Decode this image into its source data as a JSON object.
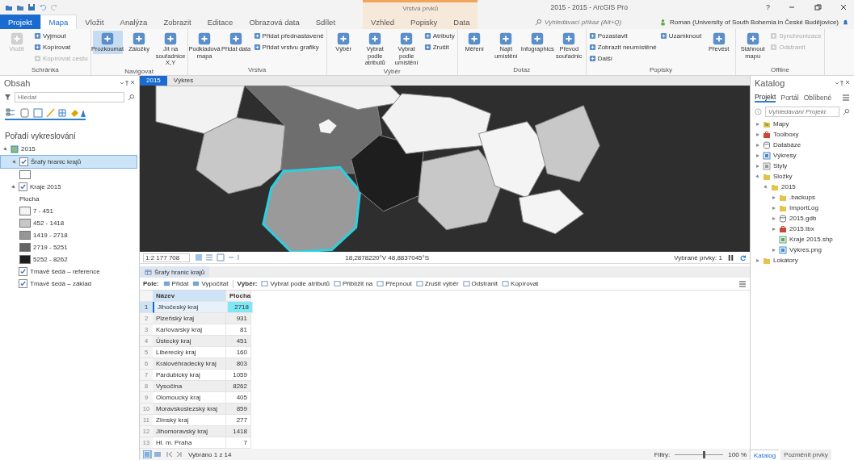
{
  "window": {
    "title": "2015 - 2015 - ArcGIS Pro",
    "context_label": "Vrstva prvků",
    "help": "?"
  },
  "ribbon_tabs": [
    {
      "label": "Projekt",
      "kind": "app",
      "selected": false
    },
    {
      "label": "Mapa",
      "kind": "normal",
      "selected": true
    },
    {
      "label": "Vložit",
      "kind": "normal",
      "selected": false
    },
    {
      "label": "Analýza",
      "kind": "normal",
      "selected": false
    },
    {
      "label": "Zobrazit",
      "kind": "normal",
      "selected": false
    },
    {
      "label": "Editace",
      "kind": "normal",
      "selected": false
    },
    {
      "label": "Obrazová data",
      "kind": "normal",
      "selected": false
    },
    {
      "label": "Sdílet",
      "kind": "normal",
      "selected": false
    },
    {
      "label": "Vzhled",
      "kind": "context",
      "selected": false
    },
    {
      "label": "Popisky",
      "kind": "context",
      "selected": false
    },
    {
      "label": "Data",
      "kind": "context",
      "selected": false
    }
  ],
  "command_search": {
    "placeholder": "Vyhledávací příkaz (Alt+Q)"
  },
  "user": "Roman (University of South Bohemia in České Budějovice)",
  "ribbon_groups": [
    {
      "name": "Schránka",
      "buttons": [
        {
          "label": "Vložit",
          "kind": "large",
          "disabled": true
        },
        {
          "label": "Vyjmout",
          "kind": "small",
          "disabled": false
        },
        {
          "label": "Kopírovat",
          "kind": "small",
          "disabled": false
        },
        {
          "label": "Kopírovat cestu",
          "kind": "small",
          "disabled": true
        }
      ]
    },
    {
      "name": "Navigovat",
      "buttons": [
        {
          "label": "Prozkoumat",
          "kind": "large",
          "disabled": false,
          "selected": true
        },
        {
          "label": "Záložky",
          "kind": "large",
          "disabled": false,
          "selected": false
        },
        {
          "label": "Jít na souřadnice X,Y",
          "kind": "large",
          "disabled": false,
          "selected": false
        }
      ]
    },
    {
      "name": "Vrstva",
      "buttons": [
        {
          "label": "Podkladová mapa",
          "kind": "large",
          "disabled": false
        },
        {
          "label": "Přidat data",
          "kind": "large",
          "disabled": false
        },
        {
          "label": "Přidat přednastavené",
          "kind": "small",
          "disabled": false
        },
        {
          "label": "Přidat vrstvu grafiky",
          "kind": "small",
          "disabled": false
        }
      ]
    },
    {
      "name": "Výběr",
      "buttons": [
        {
          "label": "Výběr",
          "kind": "large",
          "disabled": false
        },
        {
          "label": "Vybrat podle atributů",
          "kind": "large",
          "disabled": false
        },
        {
          "label": "Vybrat podle umístění",
          "kind": "large",
          "disabled": false
        },
        {
          "label": "Atributy",
          "kind": "small",
          "disabled": false
        },
        {
          "label": "Zrušit",
          "kind": "small",
          "disabled": false
        }
      ]
    },
    {
      "name": "Dotaz",
      "buttons": [
        {
          "label": "Měření",
          "kind": "large",
          "disabled": false
        },
        {
          "label": "Najít umístění",
          "kind": "large",
          "disabled": false
        },
        {
          "label": "Infographics",
          "kind": "large",
          "disabled": false
        },
        {
          "label": "Převod souřadnic",
          "kind": "large",
          "disabled": false
        }
      ]
    },
    {
      "name": "Popisky",
      "buttons": [
        {
          "label": "Pozastavit",
          "kind": "small",
          "disabled": false
        },
        {
          "label": "Zobrazit neumístěné",
          "kind": "small",
          "disabled": false
        },
        {
          "label": "Další",
          "kind": "small",
          "disabled": false
        },
        {
          "label": "Uzamknout",
          "kind": "small",
          "disabled": false
        },
        {
          "label": "Převést",
          "kind": "large",
          "disabled": false
        }
      ]
    },
    {
      "name": "Offline",
      "buttons": [
        {
          "label": "Stáhnout mapu",
          "kind": "large",
          "disabled": false
        },
        {
          "label": "Synchronizace",
          "kind": "small",
          "disabled": true
        },
        {
          "label": "Odstranit",
          "kind": "small",
          "disabled": true
        }
      ]
    }
  ],
  "contents": {
    "title": "Obsah",
    "search_placeholder": "Hledat",
    "heading": "Pořadí vykreslování",
    "tree": [
      {
        "label": "2015",
        "kind": "map",
        "expanded": true,
        "children": [
          {
            "label": "Šrafy hranic krajů",
            "checked": true,
            "selected": true,
            "expanded": true,
            "legend": {
              "classes": [
                {
                  "color": "#ffffff"
                }
              ]
            }
          },
          {
            "label": "Kraje 2015",
            "checked": true,
            "selected": false,
            "expanded": true,
            "legend": {
              "heading": "Plocha",
              "classes": [
                {
                  "label": "7 - 451",
                  "color": "#f4f4f4"
                },
                {
                  "label": "452 - 1418",
                  "color": "#c8c8c8"
                },
                {
                  "label": "1419 - 2718",
                  "color": "#969696"
                },
                {
                  "label": "2719 - 5251",
                  "color": "#646464"
                },
                {
                  "label": "5252 - 8262",
                  "color": "#1e1e1e"
                }
              ]
            }
          },
          {
            "label": "Tmavě šedá – reference",
            "checked": true,
            "selected": false
          },
          {
            "label": "Tmavě šedá – základ",
            "checked": true,
            "selected": false
          }
        ]
      }
    ]
  },
  "map_tabs": [
    {
      "label": "2015",
      "selected": true
    },
    {
      "label": "Výkres",
      "selected": false
    }
  ],
  "map_status": {
    "scale": "1:2 177 708",
    "coordinates": "18,2878220°V 48,8837045°S",
    "selected_features": "Vybrané prvky: 1"
  },
  "table_tab": {
    "label": "Šrafy hranic krajů"
  },
  "table_toolbar": {
    "field_label": "Pole:",
    "field_buttons": [
      "Přidat",
      "Vypočítat"
    ],
    "selection_label": "Výběr:",
    "selection_buttons": [
      "Vybrat podle atributů",
      "Přiblížit na",
      "Přepnout",
      "Zrušit výběr",
      "Odstranit",
      "Kopírovat"
    ]
  },
  "table": {
    "columns": [
      "Název",
      "Plocha"
    ],
    "rows": [
      {
        "index": "1",
        "name": "Jihočeský kraj",
        "area": "2718",
        "selected": true
      },
      {
        "index": "2",
        "name": "Plzeňský kraj",
        "area": "931",
        "selected": false
      },
      {
        "index": "3",
        "name": "Karlovarský kraj",
        "area": "81",
        "selected": false
      },
      {
        "index": "4",
        "name": "Ústecký kraj",
        "area": "451",
        "selected": false
      },
      {
        "index": "5",
        "name": "Liberecký kraj",
        "area": "160",
        "selected": false
      },
      {
        "index": "6",
        "name": "Královéhradecký kraj",
        "area": "803",
        "selected": false
      },
      {
        "index": "7",
        "name": "Pardubický kraj",
        "area": "1059",
        "selected": false
      },
      {
        "index": "8",
        "name": "Vysočina",
        "area": "8262",
        "selected": false
      },
      {
        "index": "9",
        "name": "Olomoucký kraj",
        "area": "405",
        "selected": false
      },
      {
        "index": "10",
        "name": "Moravskoslezský kraj",
        "area": "859",
        "selected": false
      },
      {
        "index": "11",
        "name": "Zlínský kraj",
        "area": "277",
        "selected": false
      },
      {
        "index": "12",
        "name": "Jihomoravský kraj",
        "area": "1418",
        "selected": false
      },
      {
        "index": "13",
        "name": "Hl. m. Praha",
        "area": "7",
        "selected": false
      }
    ]
  },
  "table_status": {
    "selected_text": "Vybráno 1 z 14",
    "filters_label": "Filtry:",
    "zoom_slider": {
      "level": 0.6
    },
    "zoom": "100 %"
  },
  "catalog": {
    "title": "Katalog",
    "tabs": [
      {
        "label": "Projekt",
        "selected": true
      },
      {
        "label": "Portál",
        "selected": false
      },
      {
        "label": "Oblíbené",
        "selected": false
      }
    ],
    "search_placeholder": "Vyhledávání Projekt",
    "tree": [
      {
        "label": "Mapy",
        "kind": "maps",
        "expanded": false
      },
      {
        "label": "Toolboxy",
        "kind": "toolbox",
        "expanded": false
      },
      {
        "label": "Databáze",
        "kind": "database",
        "expanded": false
      },
      {
        "label": "Výkresy",
        "kind": "layout",
        "expanded": false
      },
      {
        "label": "Styly",
        "kind": "style",
        "expanded": false
      },
      {
        "label": "Složky",
        "kind": "folder",
        "expanded": true,
        "children": [
          {
            "label": "2015",
            "kind": "folder",
            "expanded": true,
            "children": [
              {
                "label": ".backups",
                "kind": "folder",
                "expanded": false
              },
              {
                "label": "ImportLog",
                "kind": "folder",
                "expanded": false
              },
              {
                "label": "2015.gdb",
                "kind": "database",
                "expanded": false
              },
              {
                "label": "2015.tbx",
                "kind": "toolbox",
                "expanded": false
              },
              {
                "label": "Kraje 2015.shp",
                "kind": "shapefile"
              },
              {
                "label": "Výkres.png",
                "kind": "image",
                "expanded": false
              }
            ]
          }
        ]
      },
      {
        "label": "Lokátory",
        "kind": "folder",
        "expanded": false
      }
    ]
  },
  "bottom_tabs": [
    {
      "label": "Katalog",
      "selected": true
    },
    {
      "label": "Pozměnit prvky",
      "selected": false
    }
  ]
}
